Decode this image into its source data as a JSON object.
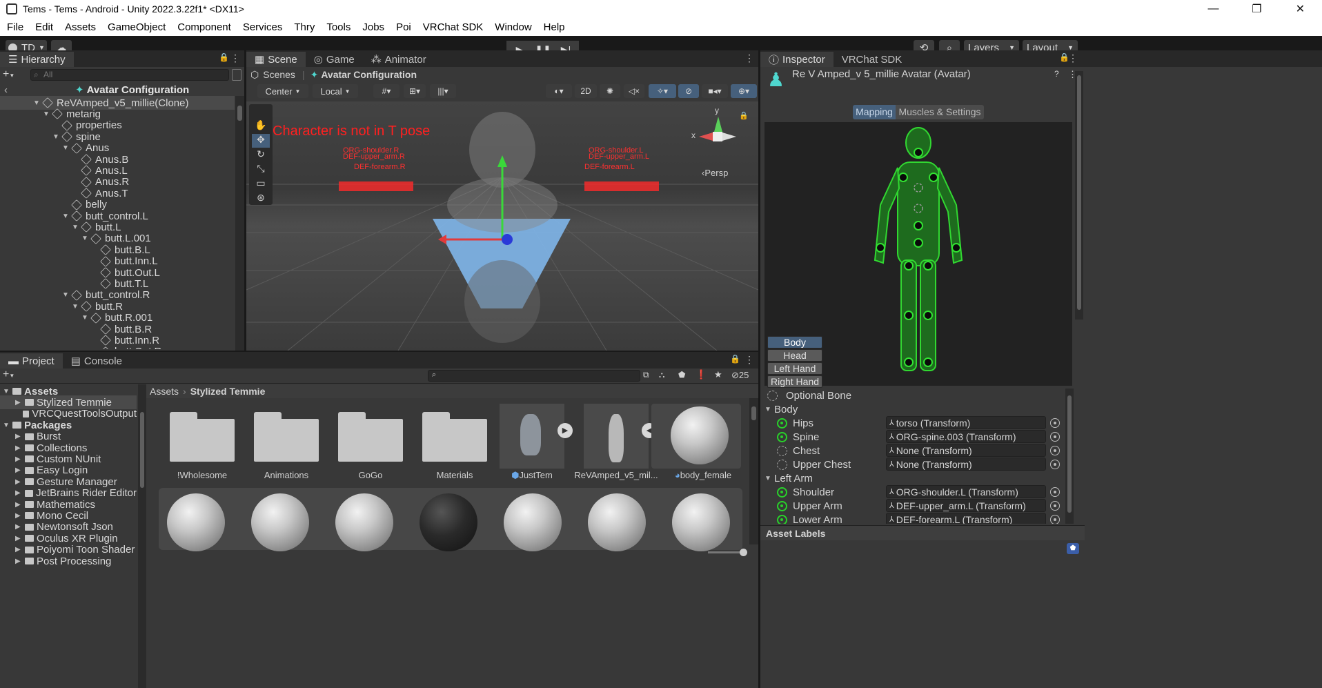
{
  "window": {
    "title": "Tems - Tems - Android - Unity 2022.3.22f1* <DX11>",
    "minimize": "—",
    "maximize": "❐",
    "close": "✕"
  },
  "menu": [
    "File",
    "Edit",
    "Assets",
    "GameObject",
    "Component",
    "Services",
    "Thry",
    "Tools",
    "Jobs",
    "Poi",
    "VRChat SDK",
    "Window",
    "Help"
  ],
  "toolbar": {
    "account": "TD",
    "layers": "Layers",
    "layout": "Layout"
  },
  "hierarchy": {
    "tab": "Hierarchy",
    "search_placeholder": "All",
    "breadcrumb": "Avatar Configuration",
    "rows": [
      {
        "label": "ReVAmped_v5_millie(Clone)",
        "depth": 0,
        "arrow": "▼"
      },
      {
        "label": "metarig",
        "depth": 1,
        "arrow": "▼"
      },
      {
        "label": "properties",
        "depth": 2,
        "arrow": ""
      },
      {
        "label": "spine",
        "depth": 2,
        "arrow": "▼"
      },
      {
        "label": "Anus",
        "depth": 3,
        "arrow": "▼"
      },
      {
        "label": "Anus.B",
        "depth": 4,
        "arrow": ""
      },
      {
        "label": "Anus.L",
        "depth": 4,
        "arrow": ""
      },
      {
        "label": "Anus.R",
        "depth": 4,
        "arrow": ""
      },
      {
        "label": "Anus.T",
        "depth": 4,
        "arrow": ""
      },
      {
        "label": "belly",
        "depth": 3,
        "arrow": ""
      },
      {
        "label": "butt_control.L",
        "depth": 3,
        "arrow": "▼"
      },
      {
        "label": "butt.L",
        "depth": 4,
        "arrow": "▼"
      },
      {
        "label": "butt.L.001",
        "depth": 5,
        "arrow": "▼"
      },
      {
        "label": "butt.B.L",
        "depth": 6,
        "arrow": ""
      },
      {
        "label": "butt.Inn.L",
        "depth": 6,
        "arrow": ""
      },
      {
        "label": "butt.Out.L",
        "depth": 6,
        "arrow": ""
      },
      {
        "label": "butt.T.L",
        "depth": 6,
        "arrow": ""
      },
      {
        "label": "butt_control.R",
        "depth": 3,
        "arrow": "▼"
      },
      {
        "label": "butt.R",
        "depth": 4,
        "arrow": "▼"
      },
      {
        "label": "butt.R.001",
        "depth": 5,
        "arrow": "▼"
      },
      {
        "label": "butt.B.R",
        "depth": 6,
        "arrow": ""
      },
      {
        "label": "butt.Inn.R",
        "depth": 6,
        "arrow": ""
      },
      {
        "label": "butt.Out.R",
        "depth": 6,
        "arrow": ""
      }
    ]
  },
  "scene": {
    "tabs": [
      "Scene",
      "Game",
      "Animator"
    ],
    "breadcrumb_root": "Scenes",
    "breadcrumb_current": "Avatar Configuration",
    "pivot": "Center",
    "space": "Local",
    "mode2d": "2D",
    "persp": "Persp",
    "warning": "Character is not in T pose",
    "bone_labels_left": [
      "ORG-shoulder.R",
      "DEF-upper_arm.R",
      "DEF-forearm.R"
    ],
    "bone_labels_right": [
      "ORG-shoulder.L",
      "DEF-upper_arm.L",
      "DEF-forearm.L"
    ],
    "gizmo_y": "y",
    "gizmo_x": "x"
  },
  "inspector": {
    "tabs": [
      "Inspector",
      "VRChat SDK"
    ],
    "title": "Re V Amped_v 5_millie Avatar (Avatar)",
    "mode_tabs": [
      "Mapping",
      "Muscles & Settings"
    ],
    "part_buttons": [
      "Body",
      "Head",
      "Left Hand",
      "Right Hand"
    ],
    "legend": "Optional Bone",
    "sections": [
      {
        "label": "Body",
        "bones": [
          {
            "name": "Hips",
            "value": "torso (Transform)",
            "mapped": true
          },
          {
            "name": "Spine",
            "value": "ORG-spine.003 (Transform)",
            "mapped": true
          },
          {
            "name": "Chest",
            "value": "None (Transform)",
            "mapped": false
          },
          {
            "name": "Upper Chest",
            "value": "None (Transform)",
            "mapped": false
          }
        ]
      },
      {
        "label": "Left Arm",
        "bones": [
          {
            "name": "Shoulder",
            "value": "ORG-shoulder.L (Transform)",
            "mapped": true
          },
          {
            "name": "Upper Arm",
            "value": "DEF-upper_arm.L (Transform)",
            "mapped": true
          },
          {
            "name": "Lower Arm",
            "value": "DEF-forearm.L (Transform)",
            "mapped": true
          }
        ]
      }
    ],
    "asset_labels": "Asset Labels"
  },
  "project": {
    "tabs": [
      "Project",
      "Console"
    ],
    "hidden_count": "25",
    "breadcrumb": [
      "Assets",
      "Stylized Temmie"
    ],
    "tree": [
      {
        "label": "Assets",
        "bold": true,
        "depth": 0,
        "arrow": "▼"
      },
      {
        "label": "Stylized Temmie",
        "depth": 1,
        "arrow": "▶",
        "selected": true
      },
      {
        "label": "VRCQuestToolsOutput",
        "depth": 1,
        "arrow": ""
      },
      {
        "label": "Packages",
        "bold": true,
        "depth": 0,
        "arrow": "▼"
      },
      {
        "label": "Burst",
        "depth": 1,
        "arrow": "▶"
      },
      {
        "label": "Collections",
        "depth": 1,
        "arrow": "▶"
      },
      {
        "label": "Custom NUnit",
        "depth": 1,
        "arrow": "▶"
      },
      {
        "label": "Easy Login",
        "depth": 1,
        "arrow": "▶"
      },
      {
        "label": "Gesture Manager",
        "depth": 1,
        "arrow": "▶"
      },
      {
        "label": "JetBrains Rider Editor",
        "depth": 1,
        "arrow": "▶"
      },
      {
        "label": "Mathematics",
        "depth": 1,
        "arrow": "▶"
      },
      {
        "label": "Mono Cecil",
        "depth": 1,
        "arrow": "▶"
      },
      {
        "label": "Newtonsoft Json",
        "depth": 1,
        "arrow": "▶"
      },
      {
        "label": "Oculus XR Plugin",
        "depth": 1,
        "arrow": "▶"
      },
      {
        "label": "Poiyomi Toon Shader",
        "depth": 1,
        "arrow": "▶"
      },
      {
        "label": "Post Processing",
        "depth": 1,
        "arrow": "▶"
      }
    ],
    "assets": [
      "!Wholesome",
      "Animations",
      "GoGo",
      "Materials",
      "JustTem",
      "ReVAmped_v5_mil...",
      "body_female"
    ]
  }
}
